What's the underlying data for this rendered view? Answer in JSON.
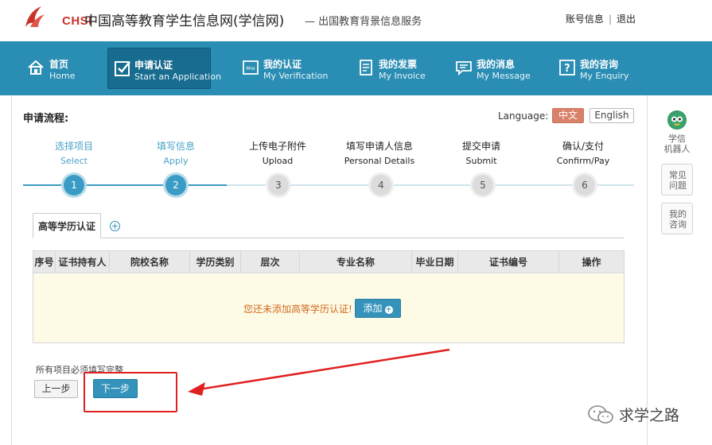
{
  "header": {
    "logo_text": "CHSI",
    "site_title": "中国高等教育学生信息网(学信网)",
    "site_subtitle": "— 出国教育背景信息服务",
    "account_link": "账号信息",
    "separator": "|",
    "logout_link": "退出"
  },
  "nav": {
    "items": [
      {
        "cn": "首页",
        "en": "Home",
        "icon": "home-icon"
      },
      {
        "cn": "申请认证",
        "en": "Start an Application",
        "icon": "checkbox-icon"
      },
      {
        "cn": "我的认证",
        "en": "My Verification",
        "icon": "verification-icon"
      },
      {
        "cn": "我的发票",
        "en": "My Invoice",
        "icon": "invoice-icon"
      },
      {
        "cn": "我的消息",
        "en": "My Message",
        "icon": "message-icon"
      },
      {
        "cn": "我的咨询",
        "en": "My Enquiry",
        "icon": "enquiry-icon"
      }
    ],
    "active_index": 1
  },
  "process": {
    "title": "申请流程:",
    "language_label": "Language:",
    "lang_cn": "中文",
    "lang_en": "English",
    "steps": [
      {
        "num": "1",
        "cn": "选择项目",
        "en": "Select",
        "state": "done"
      },
      {
        "num": "2",
        "cn": "填写信息",
        "en": "Apply",
        "state": "done"
      },
      {
        "num": "3",
        "cn": "上传电子附件",
        "en": "Upload",
        "state": "todo"
      },
      {
        "num": "4",
        "cn": "填写申请人信息",
        "en": "Personal Details",
        "state": "todo"
      },
      {
        "num": "5",
        "cn": "提交申请",
        "en": "Submit",
        "state": "todo"
      },
      {
        "num": "6",
        "cn": "确认/支付",
        "en": "Confirm/Pay",
        "state": "todo"
      }
    ]
  },
  "tabs": {
    "active_label": "高等学历认证",
    "add_symbol": "+"
  },
  "table": {
    "columns": [
      "序号",
      "证书持有人",
      "院校名称",
      "学历类别",
      "层次",
      "专业名称",
      "毕业日期",
      "证书编号",
      "操作"
    ],
    "empty_message": "您还未添加高等学历认证!",
    "add_button": "添加",
    "add_plus": "+"
  },
  "form": {
    "required_note": "所有项目必须填写完整",
    "prev_button": "上一步",
    "next_button": "下一步"
  },
  "sidebar": {
    "robot_line1": "学信",
    "robot_line2": "机器人",
    "faq_line1": "常见",
    "faq_line2": "问题",
    "enquiry_line1": "我的",
    "enquiry_line2": "咨询"
  },
  "watermark": {
    "text": "求学之路"
  },
  "colors": {
    "nav_bg": "#2a8db3",
    "nav_active": "#186c8f",
    "step_done": "#3a9cc5",
    "annotation_red": "#e02020",
    "lang_active": "#d9826b"
  }
}
